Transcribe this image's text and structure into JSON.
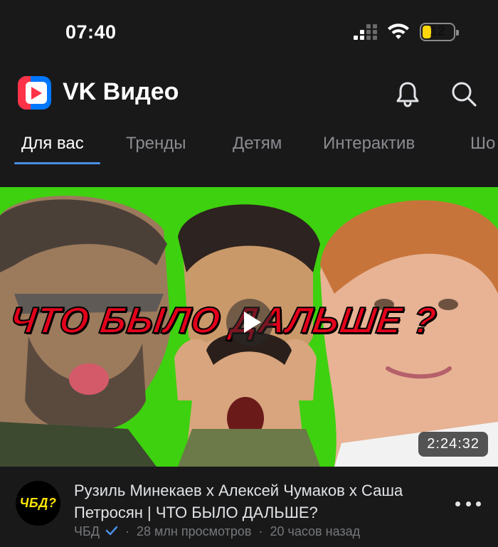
{
  "status_bar": {
    "time": "07:40",
    "battery_level": "12",
    "battery_color": "#ffd60a"
  },
  "header": {
    "app_title": "VK Видео",
    "logo_icon": "vk-video-logo-icon",
    "bell_icon": "bell-icon",
    "search_icon": "search-icon"
  },
  "tabs": [
    {
      "label": "Для вас",
      "active": true
    },
    {
      "label": "Тренды",
      "active": false
    },
    {
      "label": "Детям",
      "active": false
    },
    {
      "label": "Интерактив",
      "active": false
    },
    {
      "label": "Шо",
      "active": false
    }
  ],
  "video": {
    "thumbnail_text": "ЧТО БЫЛО ДАЛЬШЕ ?",
    "duration": "2:24:32",
    "title": "Рузиль Минекаев х Алексей Чумаков х Саша Петросян | ЧТО БЫЛО ДАЛЬШЕ?",
    "channel_name": "ЧБД",
    "channel_avatar_text": "ЧБД?",
    "views": "28 млн просмотров",
    "published": "20 часов назад",
    "accent_color": "#4b8ee6",
    "thumbnail_bg": "#3ed10f"
  }
}
